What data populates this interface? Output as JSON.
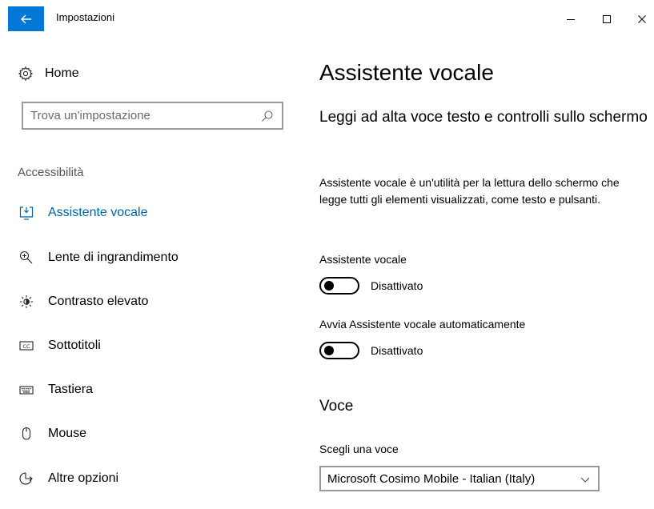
{
  "window": {
    "title": "Impostazioni",
    "controls": {
      "minimize": "minimize-icon",
      "maximize": "maximize-icon",
      "close": "close-icon"
    },
    "accent_color": "#0078d7"
  },
  "sidebar": {
    "home": {
      "label": "Home",
      "icon": "gear-icon"
    },
    "search": {
      "placeholder": "Trova un'impostazione",
      "icon": "search-icon"
    },
    "section": "Accessibilità",
    "items": [
      {
        "label": "Assistente vocale",
        "icon": "narrator-icon",
        "active": true
      },
      {
        "label": "Lente di ingrandimento",
        "icon": "magnifier-icon",
        "active": false
      },
      {
        "label": "Contrasto elevato",
        "icon": "brightness-icon",
        "active": false
      },
      {
        "label": "Sottotitoli",
        "icon": "closed-captions-icon",
        "active": false
      },
      {
        "label": "Tastiera",
        "icon": "keyboard-icon",
        "active": false
      },
      {
        "label": "Mouse",
        "icon": "mouse-icon",
        "active": false
      },
      {
        "label": "Altre opzioni",
        "icon": "more-options-icon",
        "active": false
      }
    ],
    "active_color": "#0063b1"
  },
  "main": {
    "title": "Assistente vocale",
    "subheading": "Leggi ad alta voce testo e controlli sullo schermo",
    "description": "Assistente vocale è un'utilità per la lettura dello schermo che legge tutti gli elementi visualizzati, come testo e pulsanti.",
    "settings": [
      {
        "label": "Assistente vocale",
        "state_text": "Disattivato",
        "on": false
      },
      {
        "label": "Avvia Assistente vocale automaticamente",
        "state_text": "Disattivato",
        "on": false
      }
    ],
    "voice_section": {
      "heading": "Voce",
      "label": "Scegli una voce",
      "selected": "Microsoft Cosimo Mobile - Italian (Italy)"
    }
  }
}
